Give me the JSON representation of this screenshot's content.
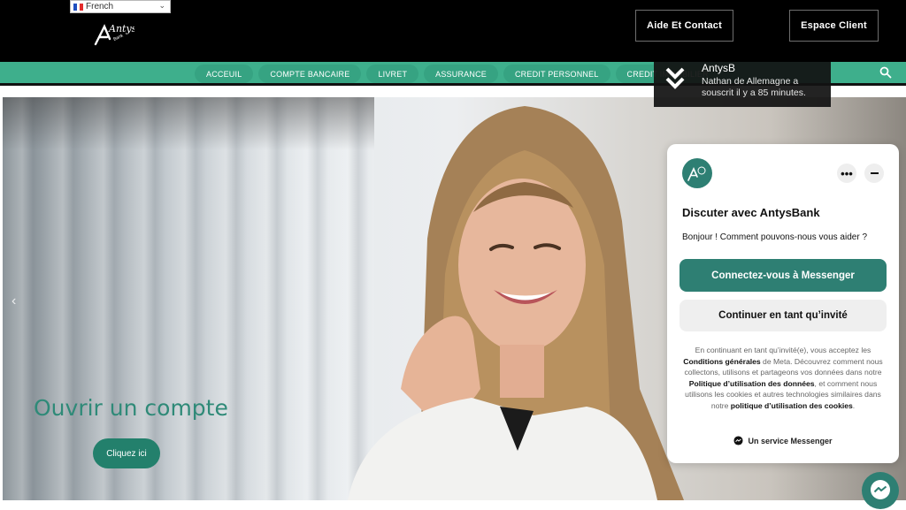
{
  "language": {
    "selected": "French",
    "flag": "fr-flag-icon"
  },
  "brand": {
    "logo_text": "Antys",
    "logo_sub": "Bank"
  },
  "header": {
    "aide_label": "Aide Et Contact",
    "espace_label": "Espace Client"
  },
  "nav": {
    "items": [
      {
        "label": "ACCEUIL"
      },
      {
        "label": "COMPTE BANCAIRE"
      },
      {
        "label": "LIVRET"
      },
      {
        "label": "ASSURANCE"
      },
      {
        "label": "CREDIT PERSONNEL"
      },
      {
        "label": "CREDIT IMMOBILIER"
      }
    ],
    "search_icon": "search-icon"
  },
  "notification": {
    "title": "AntysB",
    "body": "Nathan de Allemagne a souscrit il y a 85 minutes.",
    "icon": "double-chevron-down-icon"
  },
  "hero": {
    "caption": "Ouvrir un compte",
    "button": "Cliquez ici",
    "prev_icon": "chevron-left-icon"
  },
  "chat": {
    "title": "Discuter avec AntysBank",
    "greeting": "Bonjour ! Comment pouvons-nous vous aider ?",
    "connect_button": "Connectez-vous à Messenger",
    "guest_button": "Continuer en tant qu’invité",
    "legal": {
      "p1": "En continuant en tant qu’invité(e), vous acceptez les ",
      "l1": "Conditions générales",
      "p2": " de Meta. Découvrez comment nous collectons, utilisons et partageons vos données dans notre ",
      "l2": "Politique d’utilisation des données",
      "p3": ", et comment nous utilisons les cookies et autres technologies similaires dans notre ",
      "l3": "politique d’utilisation des cookies",
      "p4": "."
    },
    "service": "Un service Messenger",
    "more_glyph": "•••"
  },
  "colors": {
    "accent": "#2e7f73",
    "nav_green": "#3eaf8c",
    "header_bg": "#000000"
  }
}
